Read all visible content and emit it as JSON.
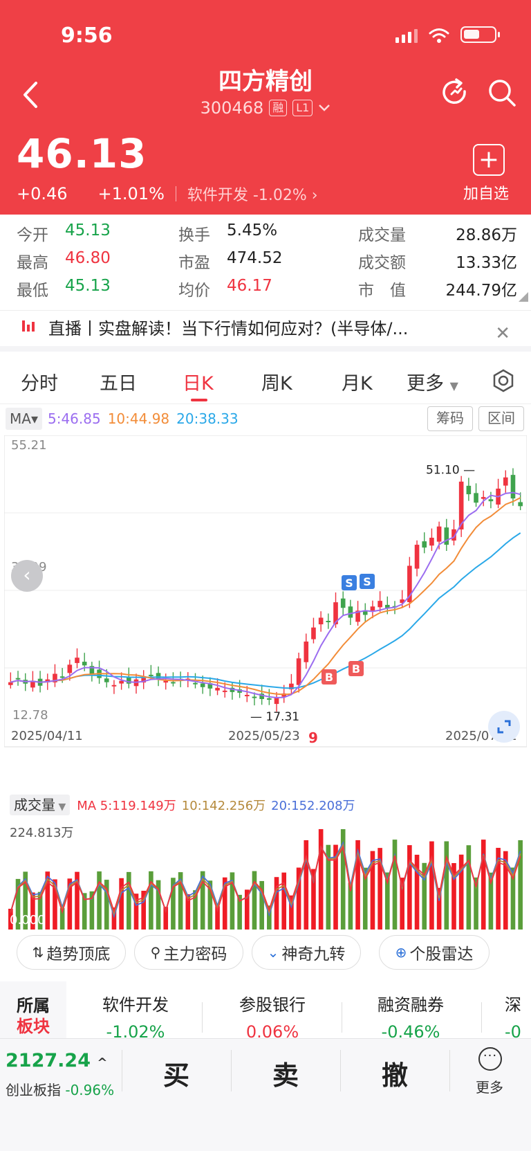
{
  "status_bar": {
    "time": "9:56"
  },
  "header": {
    "stock_name": "四方精创",
    "code": "300468",
    "tag_margin": "融",
    "tag_level": "L1",
    "price": "46.13",
    "change": "+0.46",
    "change_pct": "+1.01%",
    "sector_text": "软件开发  -1.02%",
    "add_watch_label": "加自选"
  },
  "stats": {
    "open_label": "今开",
    "open": "45.13",
    "high_label": "最高",
    "high": "46.80",
    "low_label": "最低",
    "low": "45.13",
    "turnover_label": "换手",
    "turnover": "5.45%",
    "pe_label": "市盈",
    "pe": "474.52",
    "avg_label": "均价",
    "avg": "46.17",
    "volume_label": "成交量",
    "volume": "28.86万",
    "amount_label": "成交额",
    "amount": "13.33亿",
    "mktcap_label": "市　值",
    "mktcap": "244.79亿"
  },
  "live_banner": {
    "text": "直播丨实盘解读！当下行情如何应对？(半导体/..."
  },
  "tabs": [
    "分时",
    "五日",
    "日K",
    "周K",
    "月K",
    "更多"
  ],
  "active_tab": "日K",
  "chart": {
    "ma_button": "MA",
    "ma5": "5:46.85",
    "ma10": "10:44.98",
    "ma20": "20:38.33",
    "chip_button": "筹码",
    "range_button": "区间",
    "y_top": "55.21",
    "y_mid": "33.99",
    "y_bottom": "12.78",
    "high_marker": "51.10",
    "low_marker": "17.31",
    "date_start": "2025/04/11",
    "date_mid": "2025/05/23",
    "date_end": "2025/07/02",
    "vol_button": "成交量",
    "vol_ma5": "MA 5:119.149万",
    "vol_ma10": "10:142.256万",
    "vol_ma20": "20:152.208万",
    "vol_top": "224.813万",
    "vol_bottom": "0.000",
    "signal_buy": "B",
    "signal_sell": "S",
    "nine_label": "9"
  },
  "chart_data": {
    "type": "candlestick",
    "ylim": [
      12.78,
      55.21
    ],
    "x_labels": [
      "2025/04/11",
      "2025/05/23",
      "2025/07/02"
    ],
    "series_colors": {
      "ma5": "#9b6df0",
      "ma10": "#f28c38",
      "ma20": "#2aa8e8"
    },
    "volume_ylim": [
      0,
      224.813
    ]
  },
  "features": [
    "趋势顶底",
    "主力密码",
    "神奇九转",
    "个股雷达"
  ],
  "sectors": {
    "title": "所属\n板块",
    "title_line1": "所属",
    "title_line2": "板块",
    "items": [
      {
        "name": "软件开发",
        "pct": "-1.02%"
      },
      {
        "name": "参股银行",
        "pct": "0.06%"
      },
      {
        "name": "融资融券",
        "pct": "-0.46%"
      },
      {
        "name": "深",
        "pct": "-0"
      }
    ]
  },
  "bottom_bar": {
    "index_value": "2127.24",
    "index_name": "创业板指",
    "index_pct": "-0.96%",
    "buy": "买",
    "sell": "卖",
    "cancel": "撤",
    "more": "更多"
  }
}
